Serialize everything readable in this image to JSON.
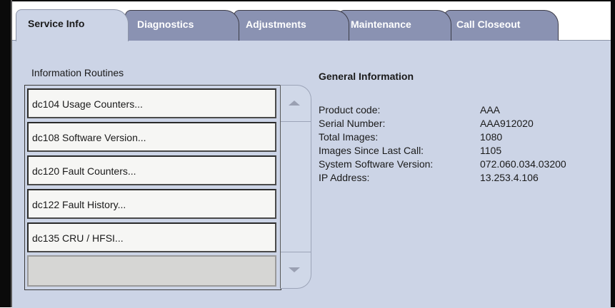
{
  "tabs": [
    {
      "label": "Service Info",
      "active": true
    },
    {
      "label": "Diagnostics",
      "active": false
    },
    {
      "label": "Adjustments",
      "active": false
    },
    {
      "label": "Maintenance",
      "active": false
    },
    {
      "label": "Call Closeout",
      "active": false
    }
  ],
  "routines": {
    "title": "Information Routines",
    "items": [
      "dc104 Usage Counters...",
      "dc108 Software Version...",
      "dc120 Fault Counters...",
      "dc122 Fault History...",
      "dc135 CRU / HFSI..."
    ]
  },
  "scrollbar": {
    "up_icon": "arrow-up-icon",
    "down_icon": "arrow-down-icon"
  },
  "general_info": {
    "title": "General Information",
    "rows": [
      {
        "label": "Product code:",
        "value": "AAA"
      },
      {
        "label": "Serial Number:",
        "value": "AAA912020"
      },
      {
        "label": "Total Images:",
        "value": "1080"
      },
      {
        "label": "Images Since Last Call:",
        "value": "1105"
      },
      {
        "label": "System Software Version:",
        "value": "072.060.034.03200"
      },
      {
        "label": "IP Address:",
        "value": "13.253.4.106"
      }
    ]
  },
  "colors": {
    "panel": "#ccd4e6",
    "tab_inactive": "#8a92b2",
    "frame": "#0a0a0a",
    "list_item": "#f6f6f4"
  }
}
